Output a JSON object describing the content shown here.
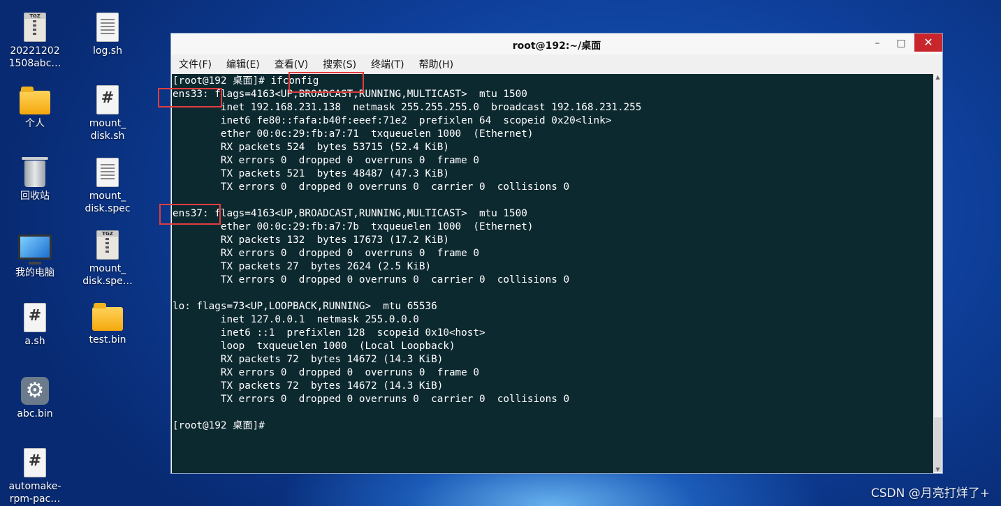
{
  "desktop": {
    "icons": [
      {
        "label": "20221202\n1508abc…",
        "icon": "tgz-archive-icon"
      },
      {
        "label": "log.sh",
        "icon": "text-file-icon"
      },
      {
        "label": "个人",
        "icon": "home-folder-icon"
      },
      {
        "label": "mount_\ndisk.sh",
        "icon": "script-file-icon"
      },
      {
        "label": "回收站",
        "icon": "trash-icon"
      },
      {
        "label": "mount_\ndisk.spec",
        "icon": "text-file-icon"
      },
      {
        "label": "我的电脑",
        "icon": "computer-icon"
      },
      {
        "label": "mount_\ndisk.spe…",
        "icon": "tgz-archive-icon"
      },
      {
        "label": "a.sh",
        "icon": "script-file-icon"
      },
      {
        "label": "test.bin",
        "icon": "folder-icon"
      },
      {
        "label": "abc.bin",
        "icon": "gear-icon"
      },
      {
        "label": "automake-\nrpm-pac…",
        "icon": "script-file-icon"
      }
    ]
  },
  "window": {
    "title": "root@192:~/桌面",
    "controls": {
      "minimize": "–",
      "maximize": "□",
      "close": "✕"
    }
  },
  "menu": [
    "文件(F)",
    "编辑(E)",
    "查看(V)",
    "搜索(S)",
    "终端(T)",
    "帮助(H)"
  ],
  "terminal": {
    "lines": [
      "[root@192 桌面]# ifconfig",
      "ens33: flags=4163<UP,BROADCAST,RUNNING,MULTICAST>  mtu 1500",
      "        inet 192.168.231.138  netmask 255.255.255.0  broadcast 192.168.231.255",
      "        inet6 fe80::fafa:b40f:eeef:71e2  prefixlen 64  scopeid 0x20<link>",
      "        ether 00:0c:29:fb:a7:71  txqueuelen 1000  (Ethernet)",
      "        RX packets 524  bytes 53715 (52.4 KiB)",
      "        RX errors 0  dropped 0  overruns 0  frame 0",
      "        TX packets 521  bytes 48487 (47.3 KiB)",
      "        TX errors 0  dropped 0 overruns 0  carrier 0  collisions 0",
      "",
      "ens37: flags=4163<UP,BROADCAST,RUNNING,MULTICAST>  mtu 1500",
      "        ether 00:0c:29:fb:a7:7b  txqueuelen 1000  (Ethernet)",
      "        RX packets 132  bytes 17673 (17.2 KiB)",
      "        RX errors 0  dropped 0  overruns 0  frame 0",
      "        TX packets 27  bytes 2624 (2.5 KiB)",
      "        TX errors 0  dropped 0 overruns 0  carrier 0  collisions 0",
      "",
      "lo: flags=73<UP,LOOPBACK,RUNNING>  mtu 65536",
      "        inet 127.0.0.1  netmask 255.0.0.0",
      "        inet6 ::1  prefixlen 128  scopeid 0x10<host>",
      "        loop  txqueuelen 1000  (Local Loopback)",
      "        RX packets 72  bytes 14672 (14.3 KiB)",
      "        RX errors 0  dropped 0  overruns 0  frame 0",
      "        TX packets 72  bytes 14672 (14.3 KiB)",
      "        TX errors 0  dropped 0 overruns 0  carrier 0  collisions 0",
      "",
      "[root@192 桌面]#"
    ]
  },
  "watermark": "CSDN @月亮打烊了+",
  "colors": {
    "terminal_bg": "#0d2930",
    "highlight": "#e23d3d",
    "close_button": "#c8262c"
  }
}
